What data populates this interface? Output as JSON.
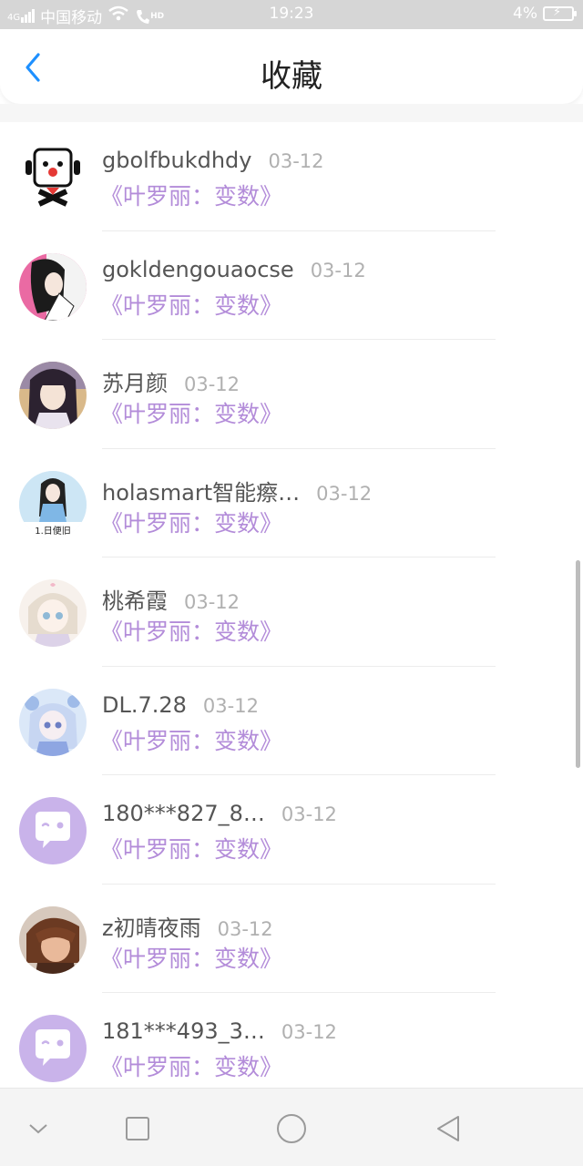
{
  "status_bar": {
    "network_label": "4G",
    "carrier": "中国移动",
    "hd_label": "HD",
    "time": "19:23",
    "battery_percent": "4%"
  },
  "header": {
    "title": "收藏",
    "back_icon": "chevron-left-icon"
  },
  "items": [
    {
      "username": "gbolfbukdhdy",
      "date": "03-12",
      "title": "《叶罗丽：变数》",
      "avatar": "cartoon-face"
    },
    {
      "username": "gokldengouaocse",
      "date": "03-12",
      "title": "《叶罗丽：变数》",
      "avatar": "anime-pink"
    },
    {
      "username": "苏月颜",
      "date": "03-12",
      "title": "《叶罗丽：变数》",
      "avatar": "anime-girl"
    },
    {
      "username": "holasmart智能瘵…",
      "date": "03-12",
      "title": "《叶罗丽：变数》",
      "avatar": "photo-girl",
      "avatar_caption": "1.日便旧"
    },
    {
      "username": "桃希霞",
      "date": "03-12",
      "title": "《叶罗丽：变数》",
      "avatar": "anime-light"
    },
    {
      "username": "DL.7.28",
      "date": "03-12",
      "title": "《叶罗丽：变数》",
      "avatar": "anime-blue"
    },
    {
      "username": "180***827_8…",
      "date": "03-12",
      "title": "《叶罗丽：变数》",
      "avatar": "default-chat"
    },
    {
      "username": "z初晴夜雨",
      "date": "03-12",
      "title": "《叶罗丽：变数》",
      "avatar": "anime-brown"
    },
    {
      "username": "181***493_3…",
      "date": "03-12",
      "title": "《叶罗丽：变数》",
      "avatar": "default-chat"
    }
  ],
  "colors": {
    "accent": "#1e90ff",
    "work_title": "#b38cd9",
    "default_avatar": "#c9b3ea"
  },
  "nav_bar": {
    "icons": [
      "chevron-down-icon",
      "square-icon",
      "circle-icon",
      "triangle-back-icon"
    ]
  }
}
